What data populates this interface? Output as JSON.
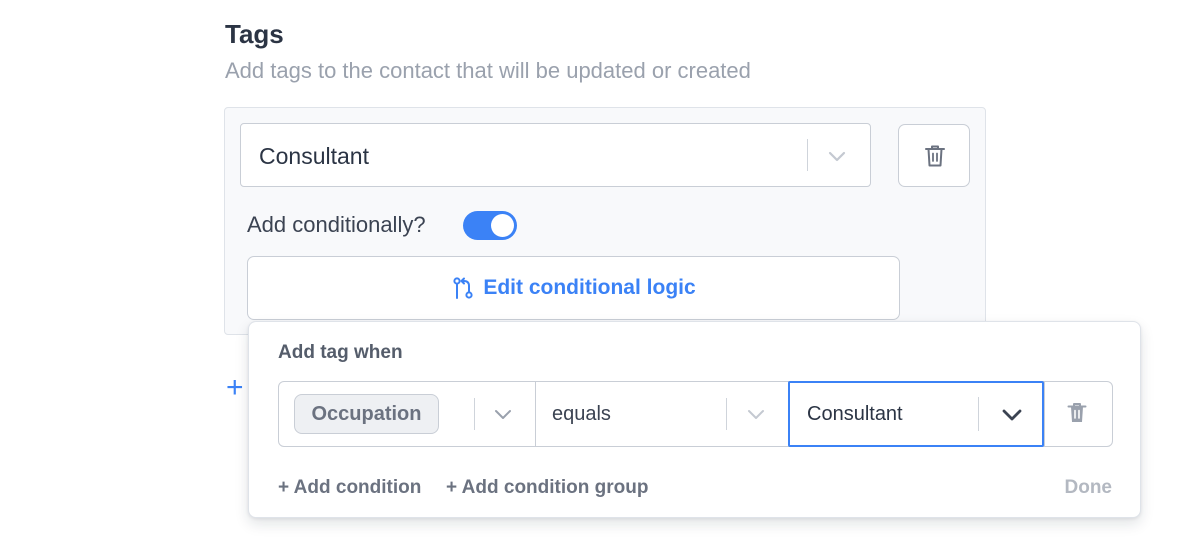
{
  "section": {
    "title": "Tags",
    "subtitle": "Add tags to the contact that will be updated or created"
  },
  "tag": {
    "selected_value": "Consultant",
    "add_conditionally_label": "Add conditionally?",
    "add_conditionally_enabled": true,
    "edit_logic_label": "Edit conditional logic"
  },
  "popover": {
    "title": "Add tag when",
    "condition": {
      "field": "Occupation",
      "operator": "equals",
      "value": "Consultant"
    },
    "add_condition_label": "+ Add condition",
    "add_group_label": "+ Add condition group",
    "done_label": "Done"
  },
  "add_tag_plus": "+",
  "colors": {
    "accent": "#3b82f6",
    "heading": "#2b3444",
    "muted": "#9aa1ad",
    "border": "#c9ced6"
  }
}
